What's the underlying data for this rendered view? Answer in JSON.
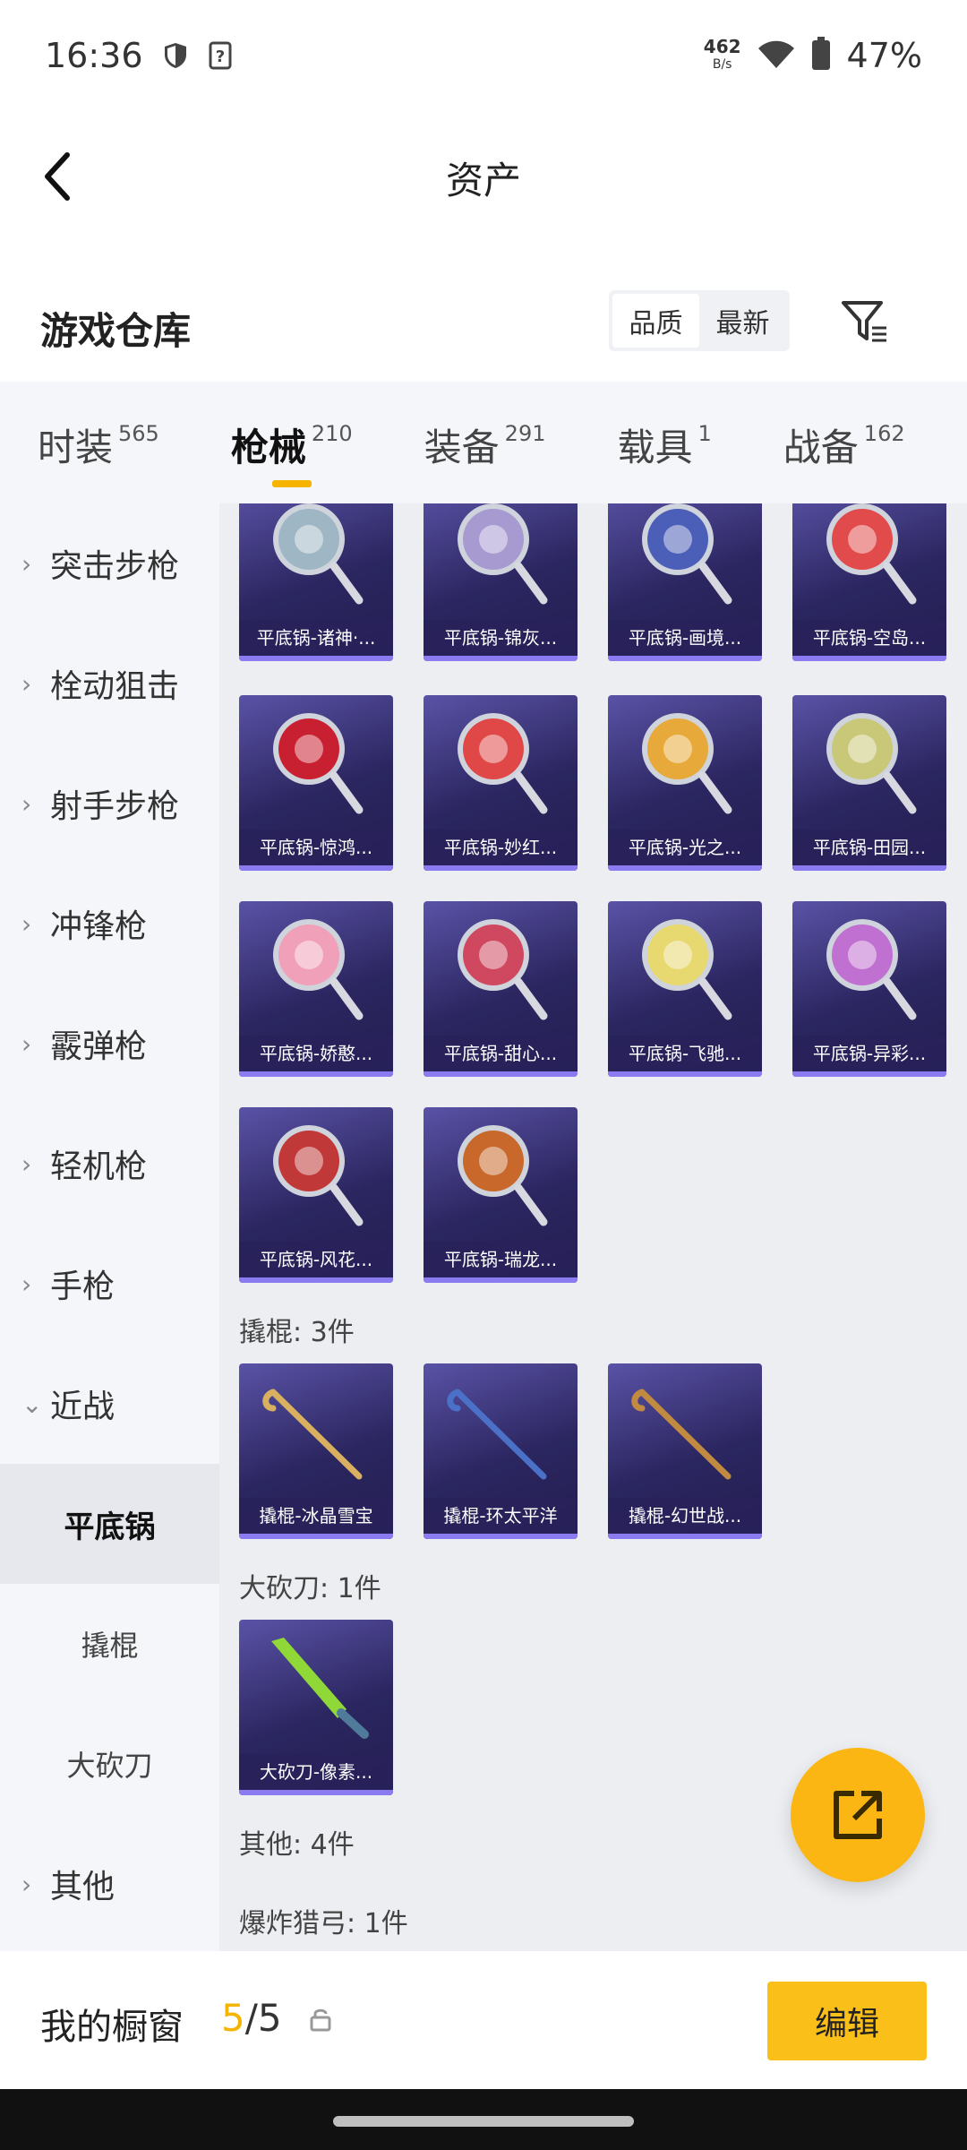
{
  "status_bar": {
    "time": "16:36",
    "net_rate": "462",
    "net_unit": "B/s",
    "battery": "47%"
  },
  "header": {
    "title": "资产"
  },
  "section": {
    "title": "游戏仓库",
    "sort_options": [
      "品质",
      "最新"
    ],
    "active_sort": "品质"
  },
  "tabs": [
    {
      "label": "时装",
      "count": "565"
    },
    {
      "label": "枪械",
      "count": "210",
      "active": true
    },
    {
      "label": "装备",
      "count": "291"
    },
    {
      "label": "载具",
      "count": "1"
    },
    {
      "label": "战备",
      "count": "162"
    }
  ],
  "sidebar": {
    "categories": [
      "突击步枪",
      "栓动狙击",
      "射手步枪",
      "冲锋枪",
      "霰弹枪",
      "轻机枪",
      "手枪"
    ],
    "melee": "近战",
    "melee_subs": [
      "平底锅",
      "撬棍",
      "大砍刀"
    ],
    "other": "其他"
  },
  "pans": [
    "平底锅-诸神·...",
    "平底锅-锦灰...",
    "平底锅-画境...",
    "平底锅-空岛...",
    "平底锅-惊鸿...",
    "平底锅-妙红...",
    "平底锅-光之...",
    "平底锅-田园...",
    "平底锅-娇憨...",
    "平底锅-甜心...",
    "平底锅-飞驰...",
    "平底锅-异彩...",
    "平底锅-风花...",
    "平底锅-瑞龙..."
  ],
  "groups": {
    "crowbar": "撬棍: 3件",
    "machete": "大砍刀: 1件",
    "other": "其他: 4件",
    "crossbow": "爆炸猎弓: 1件"
  },
  "crowbars": [
    "撬棍-冰晶雪宝",
    "撬棍-环太平洋",
    "撬棍-幻世战..."
  ],
  "machetes": [
    "大砍刀-像素..."
  ],
  "art_colors": {
    "pans": [
      "#9fb7c4",
      "#a69ad0",
      "#4b5fb8",
      "#e24b4b",
      "#c82030",
      "#e04848",
      "#e7a93a",
      "#c8c878",
      "#f0a0b8",
      "#d04860",
      "#e8d870",
      "#c070d0",
      "#c03838",
      "#c8682a"
    ],
    "crowbars": [
      "#d8b060",
      "#4a70c8",
      "#c08a40"
    ],
    "machetes": [
      "#8fd838"
    ]
  },
  "bottom": {
    "title": "我的橱窗",
    "used": "5",
    "sep": "/",
    "total": "5",
    "edit": "编辑"
  }
}
